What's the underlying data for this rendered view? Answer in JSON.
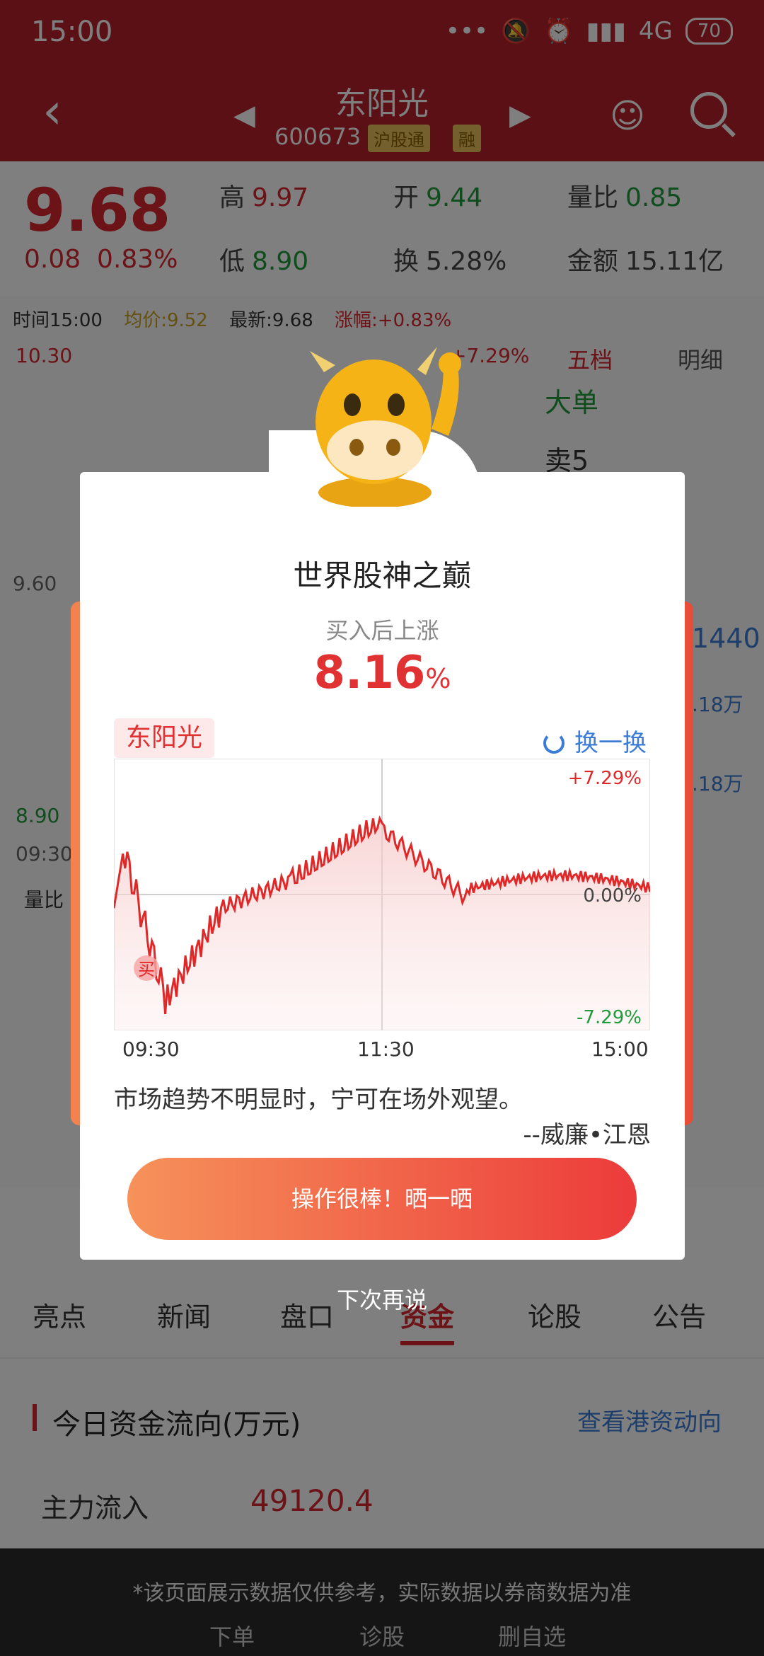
{
  "status_bar": {
    "time": "15:00",
    "network": "4G",
    "battery": "70"
  },
  "nav": {
    "title": "东阳光",
    "code": "600673",
    "tag1": "沪股通",
    "tag2": "融"
  },
  "quote": {
    "price": "9.68",
    "change": "0.08",
    "change_pct": "0.83%",
    "high_label": "高",
    "high": "9.97",
    "open_label": "开",
    "open": "9.44",
    "vol_ratio_label": "量比",
    "vol_ratio": "0.85",
    "low_label": "低",
    "low": "8.90",
    "turnover_label": "换",
    "turnover": "5.28%",
    "amount_label": "金额",
    "amount": "15.11亿"
  },
  "chart_info": {
    "time": "时间15:00",
    "avg": "均价:9.52",
    "latest": "最新:9.68",
    "range": "涨幅:+0.83%",
    "y_top": "10.30",
    "y_mid": "9.60",
    "y_bottom": "8.90",
    "time_start": "09:30",
    "vol_label": "量比",
    "pct_top": "+7.29%"
  },
  "right_panel": {
    "tab_five": "五档",
    "tab_detail": "明细",
    "big_order": "大单",
    "sell5": "卖5",
    "dash": "--",
    "val1": "1440",
    "val2": ".18万",
    "val3": ".18万"
  },
  "tabs": [
    "亮点",
    "新闻",
    "盘口",
    "资金",
    "论股",
    "公告"
  ],
  "fund": {
    "title": "今日资金流向(万元)",
    "link": "查看港资动向",
    "main_in_label": "主力流入",
    "main_in_value": "49120.4"
  },
  "bottom_bar": {
    "disclaimer": "*该页面展示数据仅供参考，实际数据以券商数据为准",
    "items": [
      "下单",
      "诊股",
      "删自选"
    ]
  },
  "modal": {
    "title": "世界股神之巅",
    "subtitle": "买入后上涨",
    "gain": "8.16",
    "gain_unit": "%",
    "stock_name": "东阳光",
    "refresh": "换一换",
    "pct_top": "+7.29%",
    "pct_mid": "0.00%",
    "pct_bottom": "-7.29%",
    "buy_marker": "买",
    "time_labels": [
      "09:30",
      "11:30",
      "15:00"
    ],
    "quote_text": "市场趋势不明显时，宁可在场外观望。",
    "quote_author": "--威廉•江恩",
    "share_button": "操作很棒！晒一晒",
    "later": "下次再说"
  },
  "colors": {
    "brand_red": "#b5202a",
    "up_red": "#e03232",
    "down_green": "#1f9b3a",
    "link_blue": "#3b7cd6"
  }
}
